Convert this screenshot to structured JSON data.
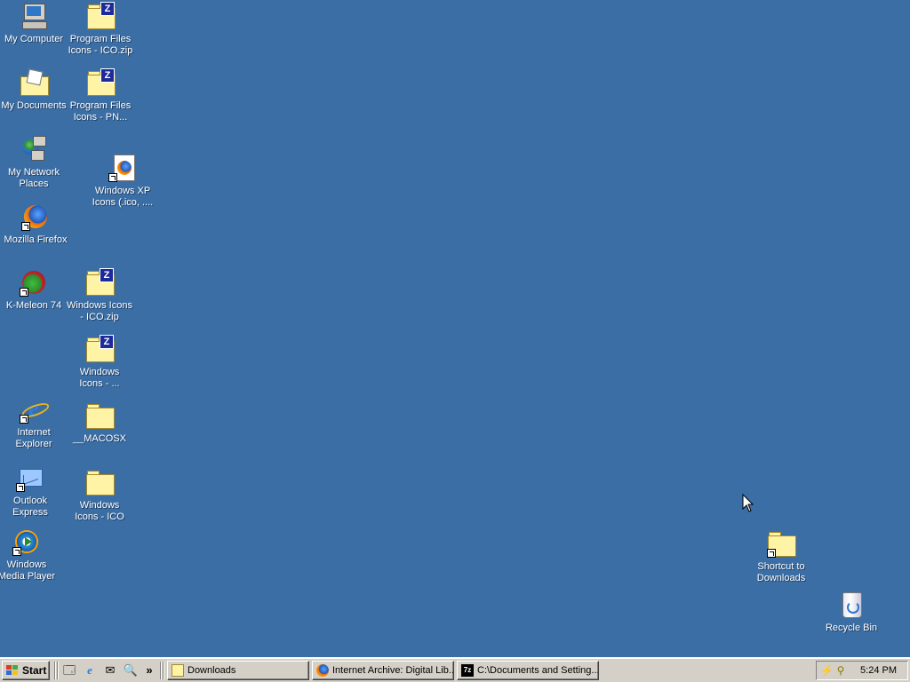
{
  "desktop": {
    "background_color": "#3a6ea5",
    "icons": {
      "my_computer": {
        "label": "My Computer",
        "icon": "computer-icon"
      },
      "my_documents": {
        "label": "My Documents",
        "icon": "documents-icon"
      },
      "my_network": {
        "label": "My Network Places",
        "icon": "network-icon"
      },
      "firefox": {
        "label": "Mozilla Firefox",
        "icon": "firefox-icon"
      },
      "kmeleon": {
        "label": "K-Meleon 74",
        "icon": "kmeleon-icon"
      },
      "ie": {
        "label": "Internet Explorer",
        "icon": "internet-explorer-icon"
      },
      "outlook": {
        "label": "Outlook Express",
        "icon": "outlook-icon"
      },
      "wmp": {
        "label": "Windows Media Player",
        "icon": "media-player-icon"
      },
      "pf_ico_zip": {
        "label": "Program Files Icons - ICO.zip",
        "icon": "zip-folder-icon",
        "badge": "Z"
      },
      "pf_png": {
        "label": "Program Files Icons - PN...",
        "icon": "zip-folder-icon",
        "badge": "Z"
      },
      "xp_icons": {
        "label": "Windows XP Icons (.ico, ....",
        "icon": "firefox-document-icon"
      },
      "win_ico_zip": {
        "label": "Windows Icons - ICO.zip",
        "icon": "zip-folder-icon",
        "badge": "Z"
      },
      "win_icons": {
        "label": "Windows Icons - ...",
        "icon": "zip-folder-icon",
        "badge": "Z"
      },
      "macosx": {
        "label": "__MACOSX",
        "icon": "folder-icon"
      },
      "win_ico": {
        "label": "Windows Icons - ICO",
        "icon": "folder-icon"
      },
      "downloads": {
        "label": "Shortcut to Downloads",
        "icon": "folder-icon"
      },
      "recycle": {
        "label": "Recycle Bin",
        "icon": "recycle-bin-icon"
      }
    }
  },
  "taskbar": {
    "start_label": "Start",
    "quicklaunch": [
      "show-desktop-icon",
      "ie-icon",
      "outlook-icon",
      "search-icon"
    ],
    "chevron": "»",
    "tasks": [
      {
        "label": "Downloads",
        "icon": "folder-icon"
      },
      {
        "label": "Internet Archive: Digital Lib...",
        "icon": "firefox-icon"
      },
      {
        "label": "C:\\Documents and Setting...",
        "icon": "7zip-icon"
      }
    ],
    "clock": "5:24 PM"
  }
}
